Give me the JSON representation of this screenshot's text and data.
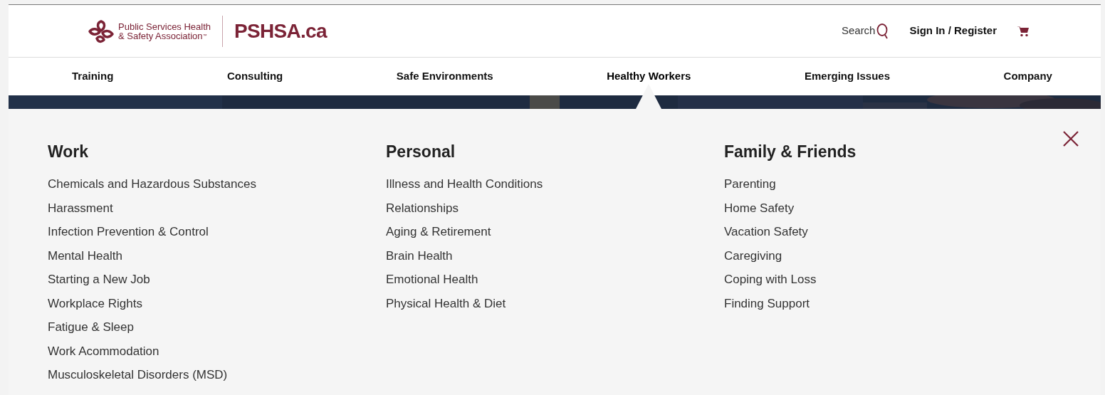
{
  "header": {
    "logo_text": [
      "Public Services Health",
      "& Safety Association"
    ],
    "trademark": "™",
    "site_name": "PSHSA.ca",
    "search_label": "Search",
    "sign_in": "Sign In / Register"
  },
  "nav": [
    {
      "label": "Training",
      "selected": false
    },
    {
      "label": "Consulting",
      "selected": false
    },
    {
      "label": "Safe Environments",
      "selected": false
    },
    {
      "label": "Healthy Workers",
      "selected": true
    },
    {
      "label": "Emerging Issues",
      "selected": false
    },
    {
      "label": "Company",
      "selected": false
    }
  ],
  "menu": {
    "columns": [
      {
        "heading": "Work",
        "links": [
          "Chemicals and Hazardous Substances",
          "Harassment",
          "Infection Prevention & Control",
          "Mental Health",
          "Starting a New Job",
          "Workplace Rights",
          "Fatigue & Sleep",
          "Work Acommodation",
          "Musculoskeletal Disorders (MSD)"
        ]
      },
      {
        "heading": "Personal",
        "links": [
          "Illness and Health Conditions",
          "Relationships",
          "Aging & Retirement",
          "Brain Health",
          "Emotional Health",
          "Physical Health & Diet"
        ]
      },
      {
        "heading": "Family & Friends",
        "links": [
          "Parenting",
          "Home Safety",
          "Vacation Safety",
          "Caregiving",
          "Coping with Loss",
          "Finding Support"
        ]
      }
    ]
  }
}
